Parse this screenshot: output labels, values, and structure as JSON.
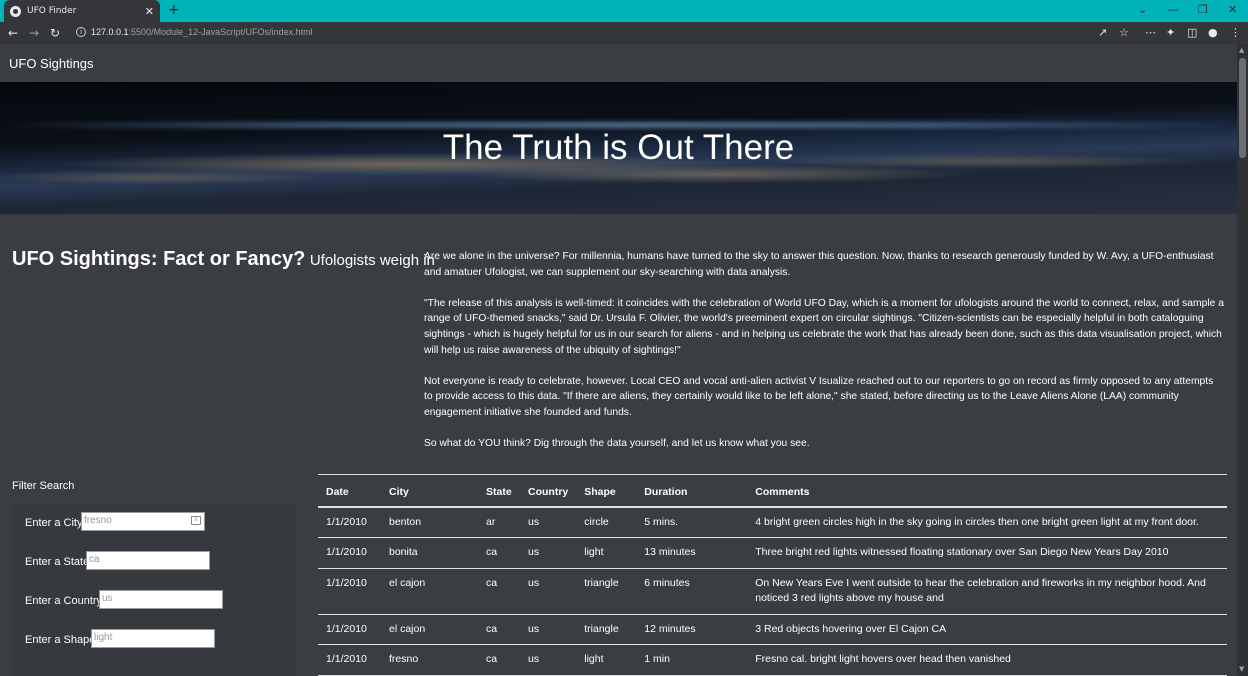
{
  "browser": {
    "tab_title": "UFO Finder",
    "tab_close": "✕",
    "new_tab": "+",
    "url_host": "127.0.0.1",
    "url_path": ":5500/Module_12-JavaScript/UFOs/index.html",
    "icons": [
      "back-icon",
      "forward-icon",
      "reload-icon",
      "site-info-icon",
      "share-icon",
      "bookmark-star-icon",
      "extension-dots-icon",
      "puzzle-extensions-icon",
      "side-panel-icon",
      "profile-icon",
      "menu-icon"
    ],
    "window_controls": [
      "⌄",
      "—",
      "❐",
      "✕"
    ]
  },
  "navbar": {
    "brand": "UFO Sightings"
  },
  "hero": {
    "title": "The Truth is Out There"
  },
  "article": {
    "heading": "UFO Sightings: Fact or Fancy?",
    "subheading": "Ufologists weigh in",
    "paragraphs": [
      "Are we alone in the universe? For millennia, humans have turned to the sky to answer this question. Now, thanks to research generously funded by W. Avy, a UFO-enthusiast and amatuer Ufologist, we can supplement our sky-searching with data analysis.",
      "\"The release of this analysis is well-timed: it coincides with the celebration of World UFO Day, which is a moment for ufologists around the world to connect, relax, and sample a range of UFO-themed snacks,\" said Dr. Ursula F. Olivier, the world's preeminent expert on circular sightings. \"Citizen-scientists can be especially helpful in both cataloguing sightings - which is hugely helpful for us in our search for aliens - and in helping us celebrate the work that has already been done, such as this data visualisation project, which will help us raise awareness of the ubiquity of sightings!\"",
      "Not everyone is ready to celebrate, however. Local CEO and vocal anti-alien activist V Isualize reached out to our reporters to go on record as firmly opposed to any attempts to provide access to this data. \"If there are aliens, they certainly would like to be left alone,\" she stated, before directing us to the Leave Aliens Alone (LAA) community engagement initiative she founded and funds.",
      "So what do YOU think? Dig through the data yourself, and let us know what you see."
    ]
  },
  "filter": {
    "title": "Filter Search",
    "fields": [
      {
        "label": "Enter a City",
        "placeholder": "fresno"
      },
      {
        "label": "Enter a State",
        "placeholder": "ca"
      },
      {
        "label": "Enter a Country",
        "placeholder": "us"
      },
      {
        "label": "Enter a Shape",
        "placeholder": "light"
      }
    ]
  },
  "table": {
    "headers": [
      "Date",
      "City",
      "State",
      "Country",
      "Shape",
      "Duration",
      "Comments"
    ],
    "rows": [
      [
        "1/1/2010",
        "benton",
        "ar",
        "us",
        "circle",
        "5 mins.",
        "4 bright green circles high in the sky going in circles then one bright green light at my front door."
      ],
      [
        "1/1/2010",
        "bonita",
        "ca",
        "us",
        "light",
        "13 minutes",
        "Three bright red lights witnessed floating stationary over San Diego New Years Day 2010"
      ],
      [
        "1/1/2010",
        "el cajon",
        "ca",
        "us",
        "triangle",
        "6 minutes",
        "On New Years Eve I went outside to hear the celebration and fireworks in my neighbor hood. And noticed 3 red lights above my house and"
      ],
      [
        "1/1/2010",
        "el cajon",
        "ca",
        "us",
        "triangle",
        "12 minutes",
        "3 Red objects hovering over El Cajon CA"
      ],
      [
        "1/1/2010",
        "fresno",
        "ca",
        "us",
        "light",
        "1 min",
        "Fresno cal. bright light hovers over head then vanished"
      ]
    ]
  }
}
